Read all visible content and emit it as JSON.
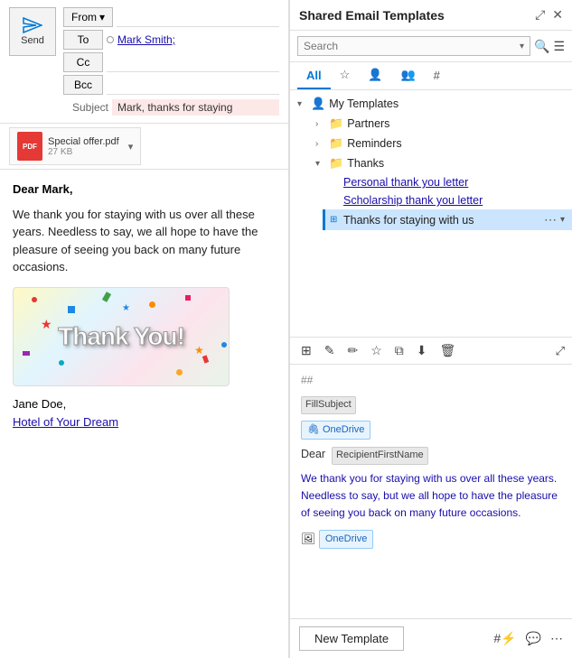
{
  "left_panel": {
    "send_label": "Send",
    "from_label": "From",
    "to_label": "To",
    "cc_label": "Cc",
    "bcc_label": "Bcc",
    "subject_label": "Subject",
    "recipient_name": "Mark Smith;",
    "subject_value": "Mark, thanks for staying",
    "attachment": {
      "name": "Special offer.pdf",
      "size": "27 KB"
    },
    "body": {
      "greeting": "Dear Mark,",
      "paragraph": "We thank you for staying with us over all these years. Needless to say, we all hope to have the pleasure of seeing you back on many future occasions.",
      "signature_name": "Jane Doe,",
      "signature_link": "Hotel of Your Dream"
    }
  },
  "right_panel": {
    "title": "Shared Email Templates",
    "pin_icon": "📌",
    "close_icon": "✕",
    "search_placeholder": "Search",
    "tabs": [
      {
        "label": "All",
        "icon": ""
      },
      {
        "label": "★",
        "icon": ""
      },
      {
        "label": "👤",
        "icon": ""
      },
      {
        "label": "👥",
        "icon": ""
      },
      {
        "label": "#",
        "icon": ""
      }
    ],
    "tree": [
      {
        "id": "my-templates",
        "label": "My Templates",
        "type": "group",
        "expanded": true,
        "indent": 0
      },
      {
        "id": "partners",
        "label": "Partners",
        "type": "folder",
        "expanded": false,
        "indent": 1
      },
      {
        "id": "reminders",
        "label": "Reminders",
        "type": "folder",
        "expanded": false,
        "indent": 1
      },
      {
        "id": "thanks",
        "label": "Thanks",
        "type": "folder",
        "expanded": true,
        "indent": 1
      },
      {
        "id": "personal-thank",
        "label": "Personal thank you letter",
        "type": "template",
        "indent": 2
      },
      {
        "id": "scholarship-thank",
        "label": "Scholarship thank you letter",
        "type": "template",
        "indent": 2
      },
      {
        "id": "thanks-for-staying",
        "label": "Thanks for staying with us",
        "type": "template",
        "indent": 2,
        "selected": true
      }
    ],
    "toolbar_icons": [
      "paste",
      "edit",
      "pencil",
      "star",
      "copy",
      "download",
      "delete"
    ],
    "preview": {
      "hash": "##",
      "fill_subject": "FillSubject",
      "onedrive_label": "OneDrive",
      "dear_label": "Dear",
      "recipient_tag": "RecipientFirstName",
      "body_text": "We thank you for staying with us over all these years. Needless to say, but we all hope to have the pleasure of seeing you back on many future occasions.",
      "onedrive_bottom": "OneDrive"
    },
    "footer": {
      "new_template_label": "New Template",
      "lightning_icon": "#⚡",
      "chat_icon": "💬",
      "more_icon": "⋯"
    }
  }
}
